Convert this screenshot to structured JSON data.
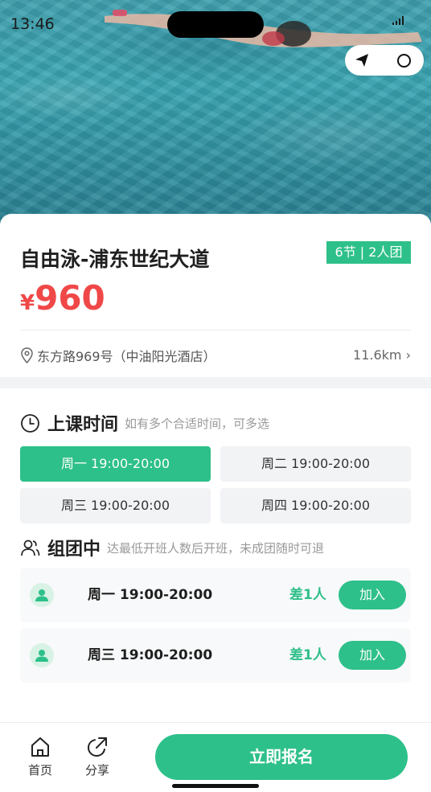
{
  "status": {
    "time": "13:46"
  },
  "course": {
    "title": "自由泳-浦东世纪大道",
    "badge": "6节 | 2人团",
    "currency": "¥",
    "price": "960",
    "address": "东方路969号（中油阳光酒店）",
    "distance": "11.6km ›"
  },
  "schedule": {
    "title": "上课时间",
    "subtitle": "如有多个合适时间，可多选",
    "slots": [
      {
        "label": "周一 19:00-20:00",
        "selected": true
      },
      {
        "label": "周二 19:00-20:00",
        "selected": false
      },
      {
        "label": "周三 19:00-20:00",
        "selected": false
      },
      {
        "label": "周四 19:00-20:00",
        "selected": false
      }
    ]
  },
  "groups": {
    "title": "组团中",
    "subtitle": "达最低开班人数后开班，未成团随时可退",
    "items": [
      {
        "time": "周一 19:00-20:00",
        "need": "差1人",
        "join": "加入"
      },
      {
        "time": "周三 19:00-20:00",
        "need": "差1人",
        "join": "加入"
      }
    ]
  },
  "bottom": {
    "home": "首页",
    "share": "分享",
    "cta": "立即报名"
  },
  "colors": {
    "accent": "#2ec08a",
    "price": "#f04848"
  },
  "icons": [
    "location-pin-icon",
    "clock-icon",
    "people-icon",
    "person-icon",
    "home-icon",
    "share-icon",
    "send-icon",
    "record-icon"
  ]
}
